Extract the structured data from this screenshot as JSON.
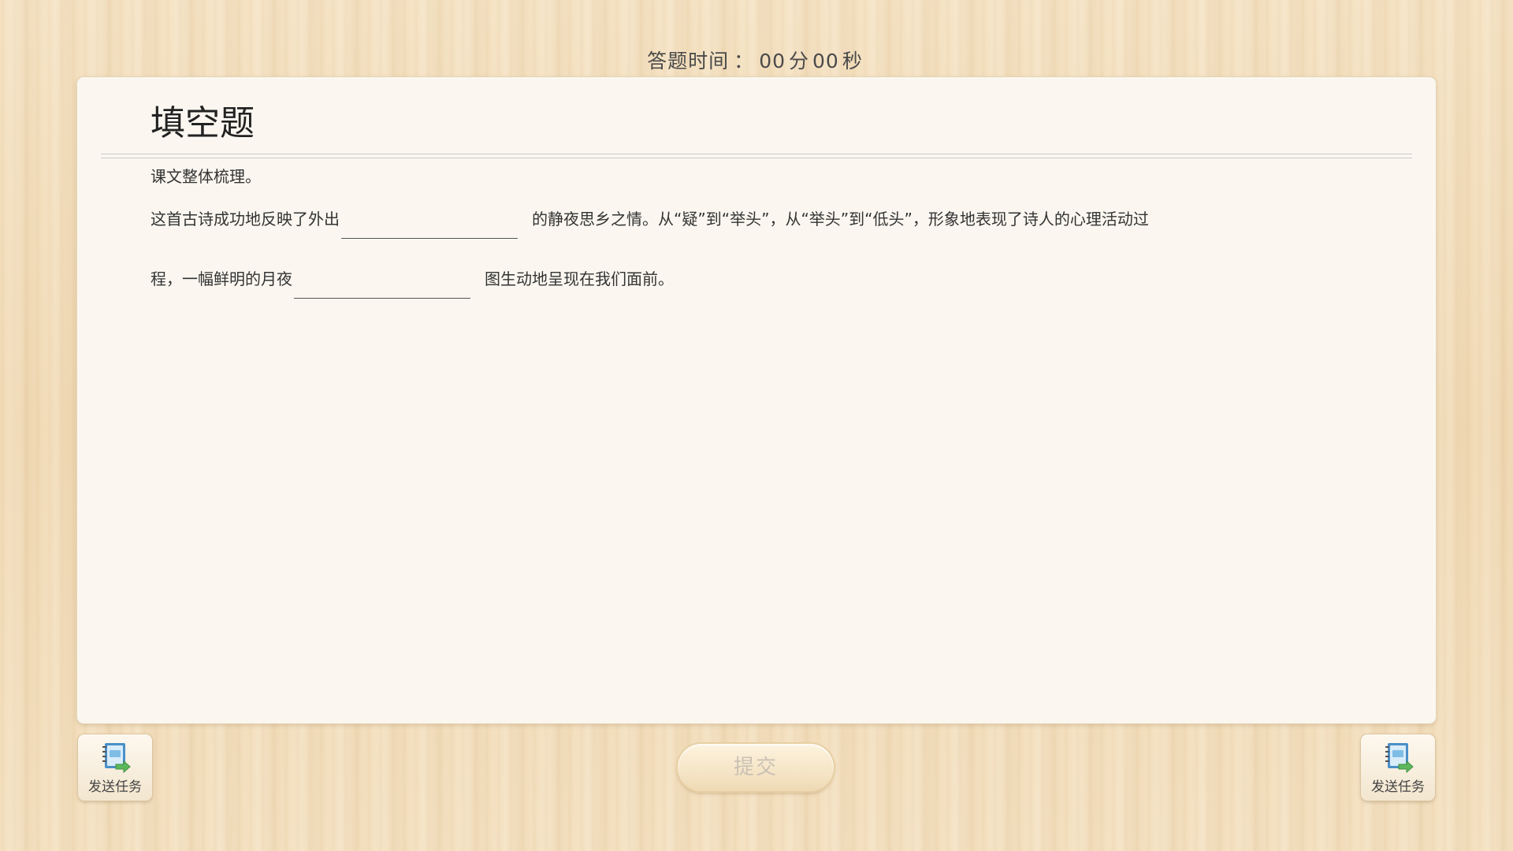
{
  "timer": {
    "label": "答题时间",
    "separator": "：",
    "minutes": "00",
    "minutes_unit": "分",
    "seconds": "00",
    "seconds_unit": "秒"
  },
  "question": {
    "type_title": "填空题",
    "section": "课文整体梳理。",
    "line1_before": "这首古诗成功地反映了外出",
    "line1_after": "的静夜思乡之情。从“疑”到“举头”，从“举头”到“低头”，形象地表现了诗人的心理活动过",
    "line2_before": "程，一幅鲜明的月夜",
    "line2_after": "图生动地呈现在我们面前。",
    "blank1_value": "",
    "blank2_value": ""
  },
  "buttons": {
    "send_task_left": "发送任务",
    "send_task_right": "发送任务",
    "submit": "提交"
  },
  "colors": {
    "card_bg": "#fbf7f0",
    "wood_bg": "#f2dcb9",
    "submit_text": "#c9c1b4",
    "icon_book": "#4a8fc8",
    "icon_arrow": "#5cb85c"
  }
}
